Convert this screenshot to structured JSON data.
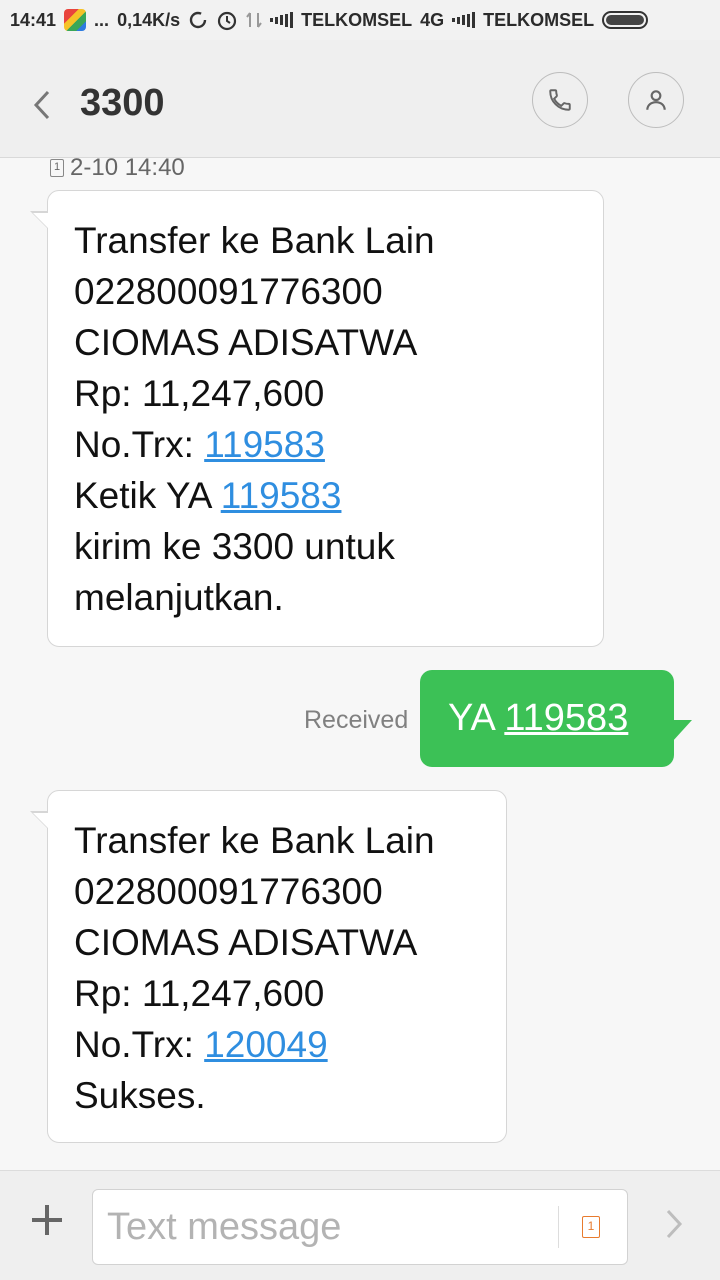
{
  "status_bar": {
    "time": "14:41",
    "dots": "...",
    "speed": "0,14K/s",
    "carrier1": "TELKOMSEL",
    "network1": "4G",
    "carrier2": "TELKOMSEL"
  },
  "header": {
    "title": "3300"
  },
  "conversation": {
    "timestamp": "2-10 14:40",
    "sim_label": "1",
    "message1": {
      "line1": "Transfer ke Bank Lain",
      "line2": "022800091776300",
      "line3": "CIOMAS ADISATWA",
      "line4": "Rp: 11,247,600",
      "line5_prefix": "No.Trx: ",
      "line5_link": "119583",
      "line6_prefix": "Ketik YA ",
      "line6_link": "119583",
      "line7": "kirim ke 3300 untuk",
      "line8": "melanjutkan."
    },
    "sent": {
      "status": "Received",
      "prefix": "YA ",
      "link": "119583"
    },
    "message2": {
      "line1": "Transfer ke Bank Lain",
      "line2": "022800091776300",
      "line3": "CIOMAS ADISATWA",
      "line4": "Rp: 11,247,600",
      "line5_prefix": "No.Trx: ",
      "line5_link": "120049",
      "line6": "Sukses."
    }
  },
  "composer": {
    "placeholder": "Text message",
    "sim_label": "1"
  },
  "colors": {
    "sent_bubble": "#3cc156",
    "link": "#2f8ee0",
    "sim_accent": "#e87b2e"
  }
}
